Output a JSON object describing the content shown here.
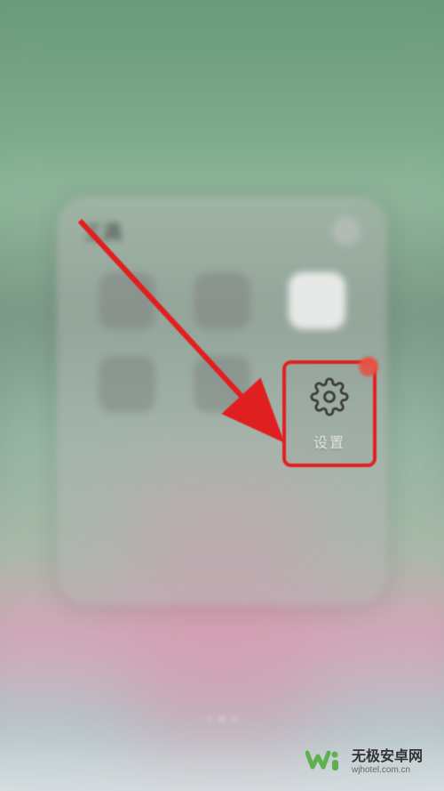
{
  "status_bar": {
    "left_text": "",
    "center_text": "",
    "right_text": ""
  },
  "folder": {
    "title": "工具",
    "apps": [
      {
        "label": "",
        "icon": "app1"
      },
      {
        "label": "",
        "icon": "app2"
      },
      {
        "label": "",
        "icon": "app3"
      },
      {
        "label": "",
        "icon": "app4"
      },
      {
        "label": "",
        "icon": "app5"
      }
    ]
  },
  "highlighted_app": {
    "label": "设置",
    "icon_name": "gear-icon",
    "has_badge": true
  },
  "annotation": {
    "arrow_color": "#e02020",
    "highlight_color": "#e02020"
  },
  "watermark": {
    "title": "无极安卓网",
    "url": "wjhotel.com.cn"
  }
}
